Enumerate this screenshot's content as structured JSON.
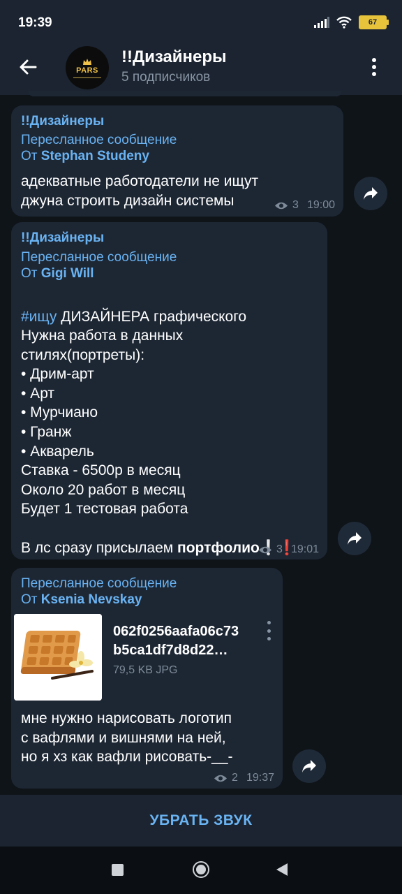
{
  "status": {
    "time": "19:39",
    "battery": "67"
  },
  "header": {
    "title": "!!Дизайнеры",
    "subtitle": "5 подписчиков",
    "avatar_text": "PARS"
  },
  "messages": [
    {
      "channel": "!!Дизайнеры",
      "forward_label": "Пересланное сообщение",
      "from_prefix": "От",
      "from_name": "Stephan Studeny",
      "text": "адекватные работодатели не ищут\nджуна строить дизайн системы",
      "views": "3",
      "time": "19:00"
    },
    {
      "channel": "!!Дизайнеры",
      "forward_label": "Пересланное сообщение",
      "from_prefix": "От",
      "from_name": "Gigi Will",
      "hashtag": "#ищу",
      "first_line_rest": " ДИЗАЙНЕРА графического",
      "text": "Нужна работа в данных\nстилях(портреты):\n• Дрим-арт\n• Арт\n• Мурчиано\n• Гранж\n• Акварель\nСтавка - 6500р в месяц\nОколо 20 работ в месяц\nБудет 1 тестовая работа",
      "last_line_prefix": "В лс сразу присылаем ",
      "last_line_bold": "портфолио",
      "last_line_suffix": "❕❗",
      "views": "3",
      "time": "19:01"
    },
    {
      "forward_label": "Пересланное сообщение",
      "from_prefix": "От",
      "from_name": "Ksenia Nevskay",
      "file_name": "062f0256aafa06c73\nb5ca1df7d8d22…",
      "file_size": "79,5 KB JPG",
      "text": "мне нужно нарисовать логотип\nс вафлями и вишнями на ней,\nно я хз как вафли рисовать-__-",
      "views": "2",
      "time": "19:37"
    }
  ],
  "bottom": {
    "mute_label": "УБРАТЬ ЗВУК"
  },
  "colors": {
    "accent": "#6ab3f3",
    "bubble": "#1d2734",
    "background": "#0f1419",
    "bar": "#1b2430"
  }
}
